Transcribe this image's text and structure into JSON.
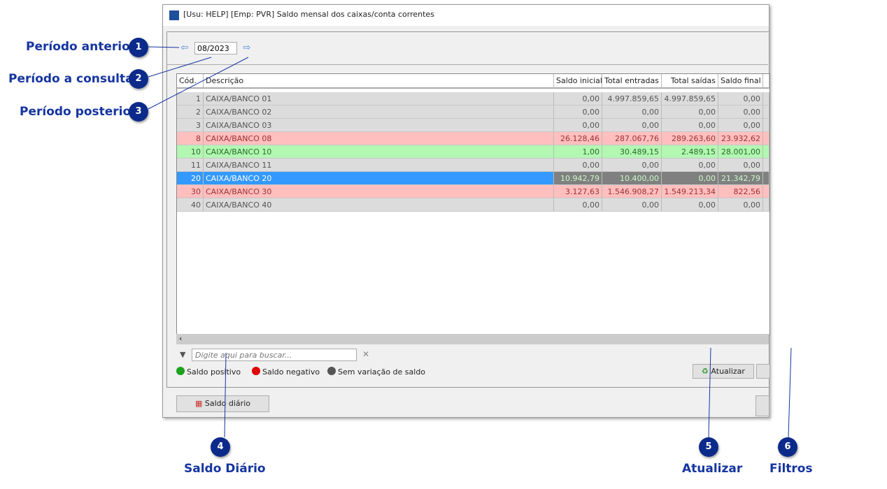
{
  "window": {
    "title": "[Usu: HELP] [Emp: PVR] Saldo mensal dos caixas/conta correntes"
  },
  "period": {
    "value": "08/2023"
  },
  "grid": {
    "columns": [
      "Cód.",
      "Descrição",
      "Saldo inicial",
      "Total entradas",
      "Total saídas",
      "Saldo final"
    ],
    "rows": [
      {
        "cod": "1",
        "desc": "CAIXA/BANCO 01",
        "ini": "0,00",
        "ent": "4.997.859,65",
        "sai": "4.997.859,65",
        "fin": "0,00",
        "status": "gray"
      },
      {
        "cod": "2",
        "desc": "CAIXA/BANCO 02",
        "ini": "0,00",
        "ent": "0,00",
        "sai": "0,00",
        "fin": "0,00",
        "status": "gray"
      },
      {
        "cod": "3",
        "desc": "CAIXA/BANCO 03",
        "ini": "0,00",
        "ent": "0,00",
        "sai": "0,00",
        "fin": "0,00",
        "status": "gray"
      },
      {
        "cod": "8",
        "desc": "CAIXA/BANCO 08",
        "ini": "26.128,46",
        "ent": "287.067,76",
        "sai": "289.263,60",
        "fin": "23.932,62",
        "status": "red"
      },
      {
        "cod": "10",
        "desc": "CAIXA/BANCO 10",
        "ini": "1,00",
        "ent": "30.489,15",
        "sai": "2.489,15",
        "fin": "28.001,00",
        "status": "green"
      },
      {
        "cod": "11",
        "desc": "CAIXA/BANCO 11",
        "ini": "0,00",
        "ent": "0,00",
        "sai": "0,00",
        "fin": "0,00",
        "status": "gray"
      },
      {
        "cod": "20",
        "desc": "CAIXA/BANCO 20",
        "ini": "10.942,79",
        "ent": "10.400,00",
        "sai": "0,00",
        "fin": "21.342,79",
        "status": "sel"
      },
      {
        "cod": "30",
        "desc": "CAIXA/BANCO 30",
        "ini": "3.127,63",
        "ent": "1.546.908,27",
        "sai": "1.549.213,34",
        "fin": "822,56",
        "status": "red"
      },
      {
        "cod": "40",
        "desc": "CAIXA/BANCO 40",
        "ini": "0,00",
        "ent": "0,00",
        "sai": "0,00",
        "fin": "0,00",
        "status": "gray"
      }
    ]
  },
  "search": {
    "placeholder": "Digite aqui para buscar..."
  },
  "legend": {
    "positive": "Saldo positivo",
    "negative": "Saldo negativo",
    "none": "Sem variação de saldo",
    "colors": {
      "positive": "#1fa01f",
      "negative": "#e00000",
      "none": "#555555"
    }
  },
  "buttons": {
    "refresh": "Atualizar",
    "daily": "Saldo diário"
  },
  "callouts": [
    {
      "n": "1",
      "label": "Período anterior"
    },
    {
      "n": "2",
      "label": "Período a consultar"
    },
    {
      "n": "3",
      "label": "Período posterior"
    },
    {
      "n": "4",
      "label": "Saldo Diário"
    },
    {
      "n": "5",
      "label": "Atualizar"
    },
    {
      "n": "6",
      "label": "Filtros"
    }
  ]
}
